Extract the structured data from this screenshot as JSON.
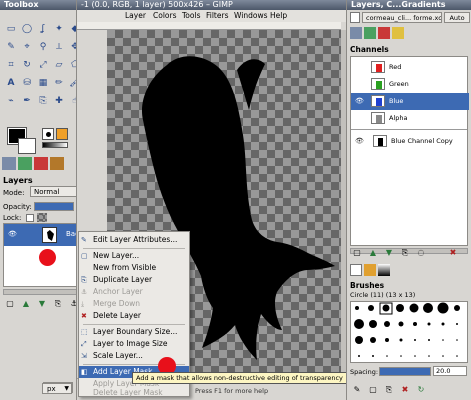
{
  "toolbox": {
    "title": "Toolbox"
  },
  "gimp": {
    "title": "-1 (0.0, RGB, 1 layer) 500x426 – GIMP",
    "menus": [
      "Layer",
      "Colors",
      "Tools",
      "Filters",
      "Windows",
      "Help"
    ],
    "zoom_unit": "px",
    "statusbar_hint": "Press F1 for more help"
  },
  "layers_dock": {
    "title": "Layers",
    "mode_label": "Mode:",
    "mode_value": "Normal",
    "opacity_label": "Opacity:",
    "opacity_value": "100.0",
    "lock_label": "Lock:",
    "layer_name": "Back"
  },
  "context_menu": {
    "items": [
      {
        "label": "Edit Layer Attributes...",
        "icon": "edit-icon",
        "enabled": true
      },
      {
        "label": "New Layer...",
        "icon": "new-icon",
        "enabled": true
      },
      {
        "label": "New from Visible",
        "icon": "",
        "enabled": true
      },
      {
        "label": "Duplicate Layer",
        "icon": "duplicate-icon",
        "enabled": true
      },
      {
        "label": "Anchor Layer",
        "icon": "anchor-icon",
        "enabled": false
      },
      {
        "label": "Merge Down",
        "icon": "merge-icon",
        "enabled": false
      },
      {
        "label": "Delete Layer",
        "icon": "delete-icon",
        "enabled": true
      },
      {
        "label": "Layer Boundary Size...",
        "icon": "boundary-icon",
        "enabled": true
      },
      {
        "label": "Layer to Image Size",
        "icon": "fit-icon",
        "enabled": true
      },
      {
        "label": "Scale Layer...",
        "icon": "scale-icon",
        "enabled": true
      },
      {
        "label": "Add Layer Mask...",
        "icon": "mask-icon",
        "enabled": true,
        "highlighted": true
      },
      {
        "label": "Apply Layer Mask",
        "icon": "",
        "enabled": false
      },
      {
        "label": "Delete Layer Mask",
        "icon": "",
        "enabled": false
      }
    ],
    "tooltip": "Add a mask that allows non-destructive editing of transparency"
  },
  "right_dock": {
    "title": "Layers, C...Gradients",
    "image_select": "cormeau_cli... forme.xcf-1",
    "auto_label": "Auto",
    "channels_title": "Channels",
    "channels": [
      {
        "name": "Red",
        "visible": false,
        "selected": false
      },
      {
        "name": "Green",
        "visible": false,
        "selected": false
      },
      {
        "name": "Blue",
        "visible": true,
        "selected": true
      },
      {
        "name": "Alpha",
        "visible": false,
        "selected": false
      }
    ],
    "channel_copy": "Blue Channel Copy",
    "brushes_title": "Brushes",
    "brush_name": "Circle (11) (13 x 13)",
    "spacing_label": "Spacing:",
    "spacing_value": "20.0"
  },
  "colors": {
    "accent": "#3d6ab3",
    "highlight": "#e8101a",
    "title_bar": "#4d586a"
  }
}
